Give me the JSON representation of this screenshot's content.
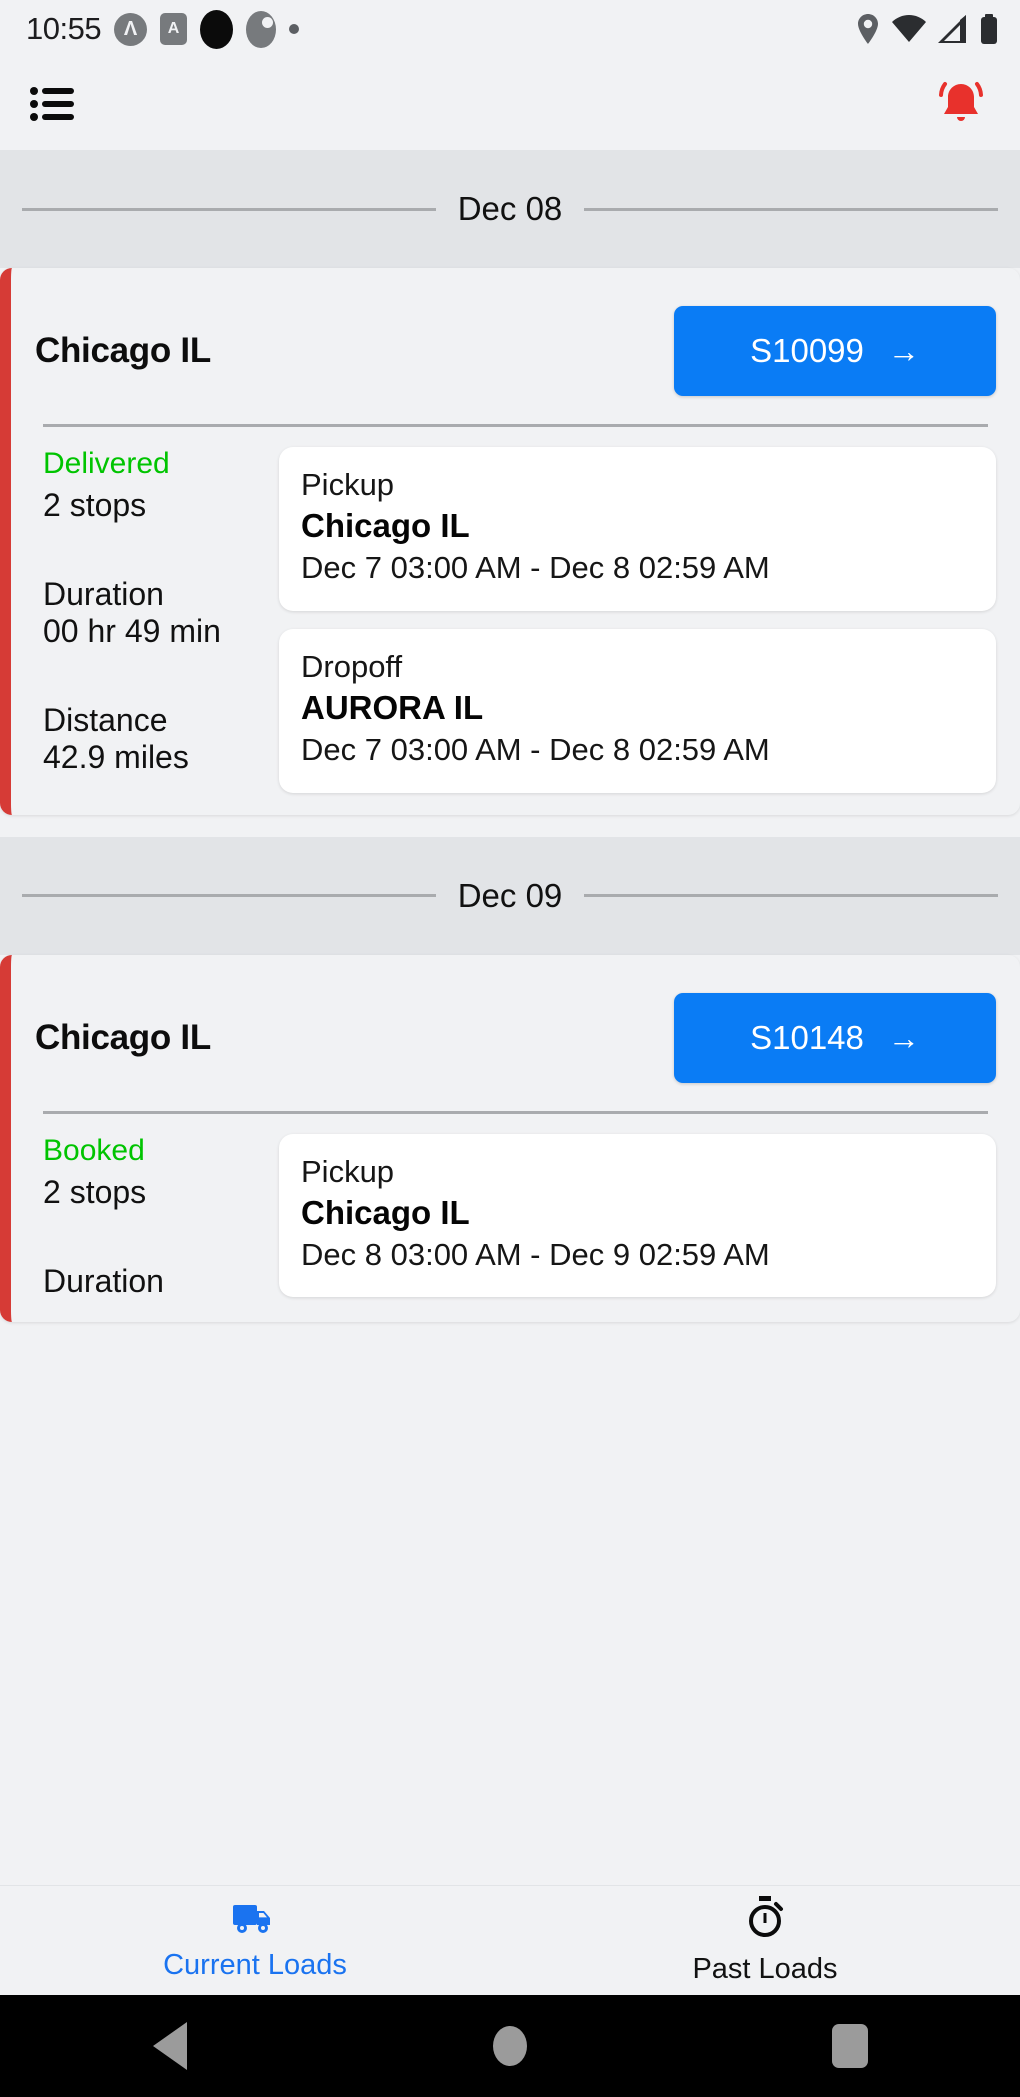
{
  "status_bar": {
    "time": "10:55",
    "left_icons": [
      "circle-a-icon",
      "square-a-icon",
      "black-dot-icon",
      "half-circle-icon",
      "tiny-dot-icon"
    ],
    "right_icons": [
      "location-pin-icon",
      "wifi-icon",
      "cellular-signal-icon",
      "battery-icon"
    ]
  },
  "app_bar": {
    "menu_icon": "list-menu-icon",
    "notification_icon": "bell-icon",
    "notification_color": "#e8312c"
  },
  "theme": {
    "accent_blue": "#0a7cf5",
    "status_green": "#00c400",
    "card_stripe_red": "#d63b36",
    "page_bg": "#f1f2f4",
    "band_bg": "#e2e4e7"
  },
  "sections": [
    {
      "date": "Dec 08",
      "card": {
        "city": "Chicago IL",
        "shipment_id": "S10099",
        "shipment_arrow": "arrow-right-icon",
        "status": "Delivered",
        "stops": "2 stops",
        "duration_label": "Duration",
        "duration_value": "00 hr 49 min",
        "distance_label": "Distance",
        "distance_value": "42.9 miles",
        "stop_list": [
          {
            "type": "Pickup",
            "city": "Chicago IL",
            "window": "Dec 7 03:00 AM - Dec 8 02:59 AM"
          },
          {
            "type": "Dropoff",
            "city": "AURORA IL",
            "window": "Dec 7 03:00 AM - Dec 8 02:59 AM"
          }
        ]
      }
    },
    {
      "date": "Dec 09",
      "card": {
        "city": "Chicago IL",
        "shipment_id": "S10148",
        "shipment_arrow": "arrow-right-icon",
        "status": "Booked",
        "stops": "2 stops",
        "duration_label": "Duration",
        "duration_value": "",
        "distance_label": "",
        "distance_value": "",
        "stop_list": [
          {
            "type": "Pickup",
            "city": "Chicago IL",
            "window": "Dec 8 03:00 AM - Dec 9 02:59 AM"
          }
        ]
      }
    }
  ],
  "bottom_nav": {
    "items": [
      {
        "label": "Current Loads",
        "icon": "truck-icon",
        "active": true
      },
      {
        "label": "Past Loads",
        "icon": "stopwatch-icon",
        "active": false
      }
    ]
  },
  "system_nav": {
    "back": "back-triangle-icon",
    "home": "home-circle-icon",
    "recent": "recent-square-icon"
  }
}
